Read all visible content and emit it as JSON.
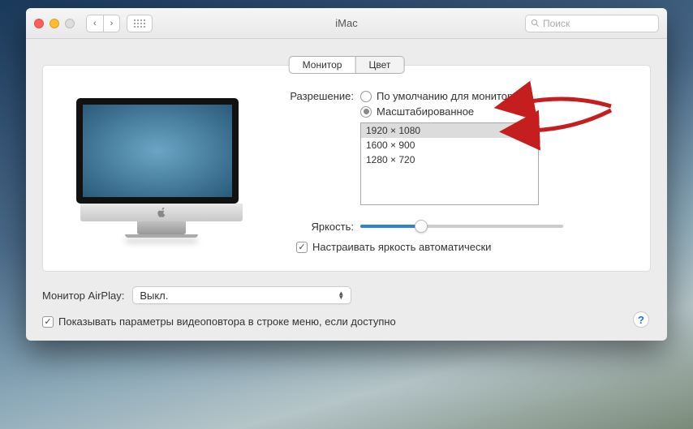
{
  "titlebar": {
    "title": "iMac",
    "search_placeholder": "Поиск"
  },
  "tabs": {
    "monitor": "Монитор",
    "color": "Цвет"
  },
  "resolution": {
    "label": "Разрешение:",
    "default_label": "По умолчанию для монитора",
    "scaled_label": "Масштабированное",
    "options": [
      "1920 × 1080",
      "1600 × 900",
      "1280 × 720"
    ]
  },
  "brightness": {
    "label": "Яркость:",
    "auto_label": "Настраивать яркость автоматически"
  },
  "airplay": {
    "label": "Монитор AirPlay:",
    "value": "Выкл."
  },
  "show_mirror_label": "Показывать параметры видеоповтора в строке меню, если доступно",
  "help_symbol": "?"
}
